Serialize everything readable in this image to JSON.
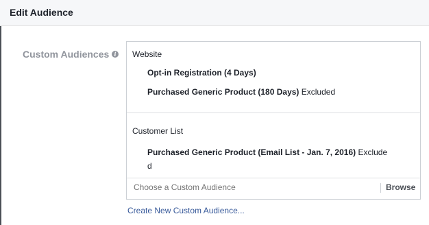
{
  "dialog": {
    "title": "Edit Audience"
  },
  "field": {
    "label": "Custom Audiences",
    "info_icon": "info-icon"
  },
  "groups": [
    {
      "label": "Website",
      "items": [
        {
          "name": "Opt-in Registration (4 Days)",
          "status": ""
        },
        {
          "name": "Purchased Generic Product (180 Days)",
          "status": "Excluded"
        }
      ]
    },
    {
      "label": "Customer List",
      "items": [
        {
          "name": "Purchased Generic Product (Email List - Jan. 7, 2016)",
          "status": "Excluded"
        }
      ]
    }
  ],
  "chooser": {
    "placeholder": "Choose a Custom Audience",
    "browse_label": "Browse"
  },
  "create_link": "Create New Custom Audience...",
  "colors": {
    "link": "#365899",
    "label_gray": "#90949c",
    "border": "#ccd0d5"
  }
}
